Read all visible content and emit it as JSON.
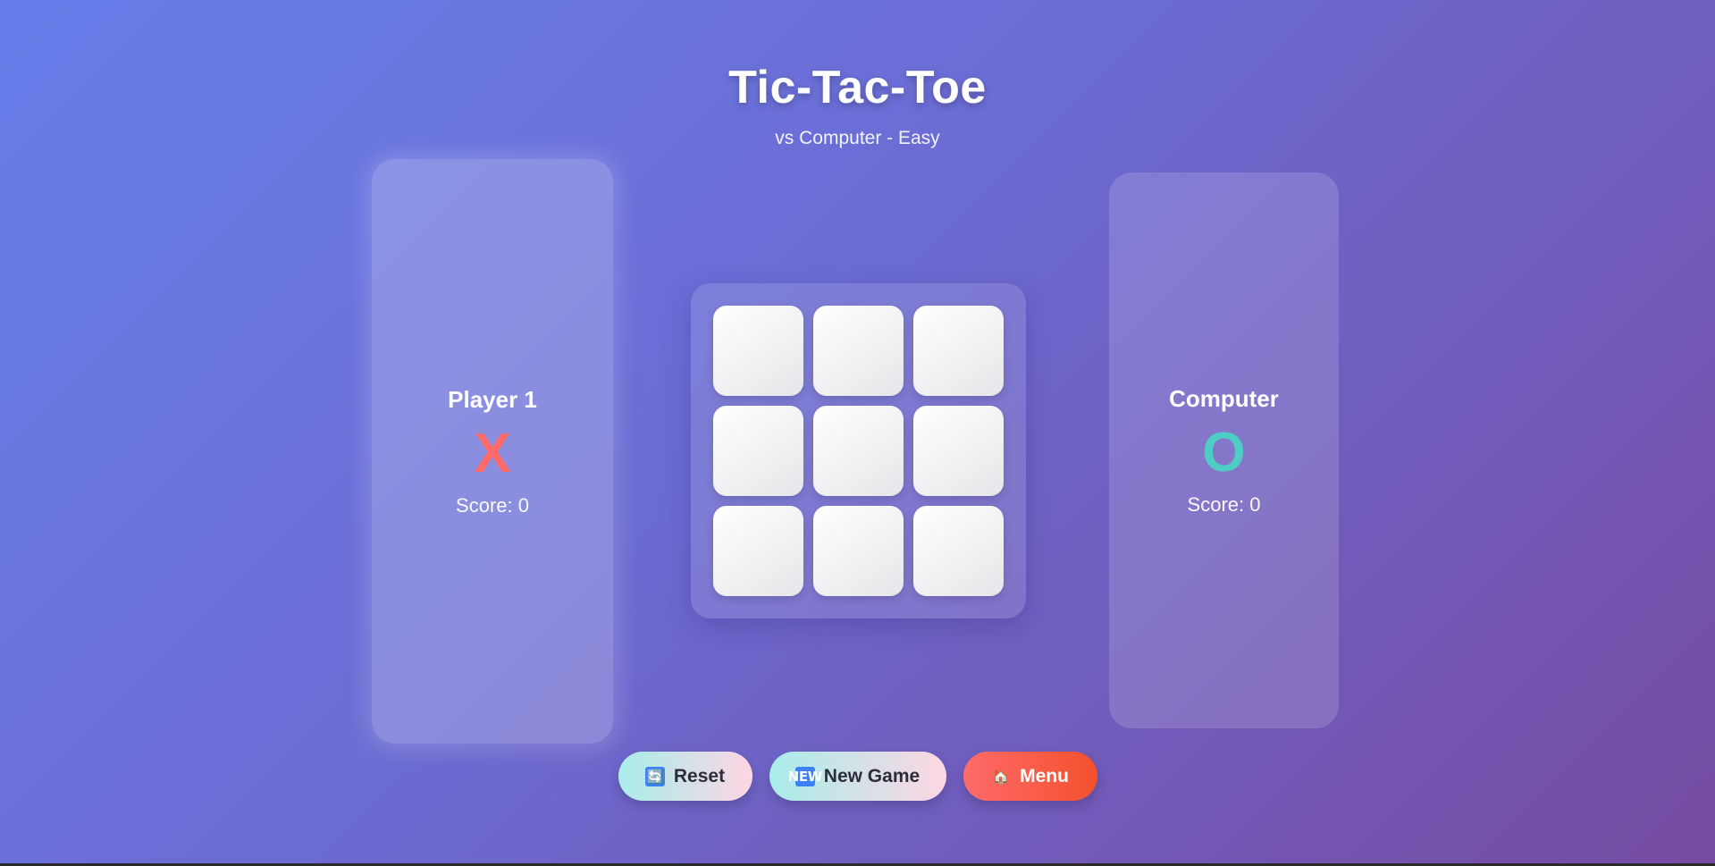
{
  "header": {
    "title": "Tic-Tac-Toe",
    "subtitle": "vs Computer - Easy"
  },
  "players": [
    {
      "name": "Player 1",
      "symbol": "X",
      "score_text": "Score: 0",
      "score": 0,
      "symbol_color": "#ff6b6b",
      "active": true
    },
    {
      "name": "Computer",
      "symbol": "O",
      "score_text": "Score: 0",
      "score": 0,
      "symbol_color": "#4ecdc4",
      "active": false
    }
  ],
  "board": {
    "cells": [
      "",
      "",
      "",
      "",
      "",
      "",
      "",
      "",
      ""
    ]
  },
  "controls": {
    "reset": {
      "label": "Reset",
      "icon": "refresh-icon",
      "glyph": "🔄"
    },
    "new_game": {
      "label": "New Game",
      "icon": "new-badge-icon",
      "glyph": "NEW"
    },
    "menu": {
      "label": "Menu",
      "icon": "home-icon",
      "glyph": "🏠"
    }
  },
  "colors": {
    "background_start": "#667eea",
    "background_end": "#764ba2",
    "x_color": "#ff6b6b",
    "o_color": "#4ecdc4",
    "menu_button": "#ff6b6b"
  }
}
